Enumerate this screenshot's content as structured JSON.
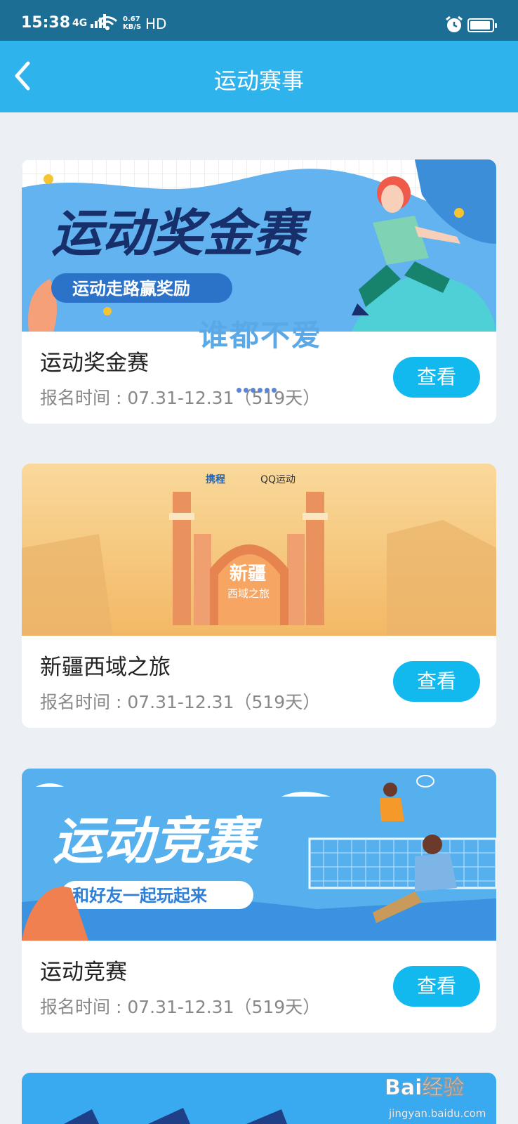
{
  "status_bar": {
    "time": "15:38",
    "network": "4G",
    "speed_value": "0.67",
    "speed_unit": "KB/S",
    "hd": "HD"
  },
  "header": {
    "title": "运动赛事",
    "back_icon": "chevron-left-icon"
  },
  "overlay": {
    "text": "谁都不爱"
  },
  "events": [
    {
      "title": "运动奖金赛",
      "date": "报名时间 : 07.31-12.31（519天）",
      "button": "查看",
      "banner_title": "运动奖金赛",
      "banner_subtitle": "运动走路赢奖励"
    },
    {
      "title": "新疆西域之旅",
      "date": "报名时间 : 07.31-12.31（519天）",
      "button": "查看",
      "banner_title": "新疆",
      "banner_subtitle": "西域之旅",
      "brand_ctrip": "携程",
      "brand_qq": "QQ运动"
    },
    {
      "title": "运动竞赛",
      "date": "报名时间 : 07.31-12.31（519天）",
      "button": "查看",
      "banner_title": "运动竞赛",
      "banner_subtitle": "和好友一起玩起来"
    }
  ],
  "watermark": {
    "brand": "Bai经验",
    "url": "jingyan.baidu.com"
  },
  "colors": {
    "status_bar": "#1d6e94",
    "nav_bar": "#2fb3ec",
    "button": "#12b9ef",
    "page_bg": "#eceff4"
  }
}
